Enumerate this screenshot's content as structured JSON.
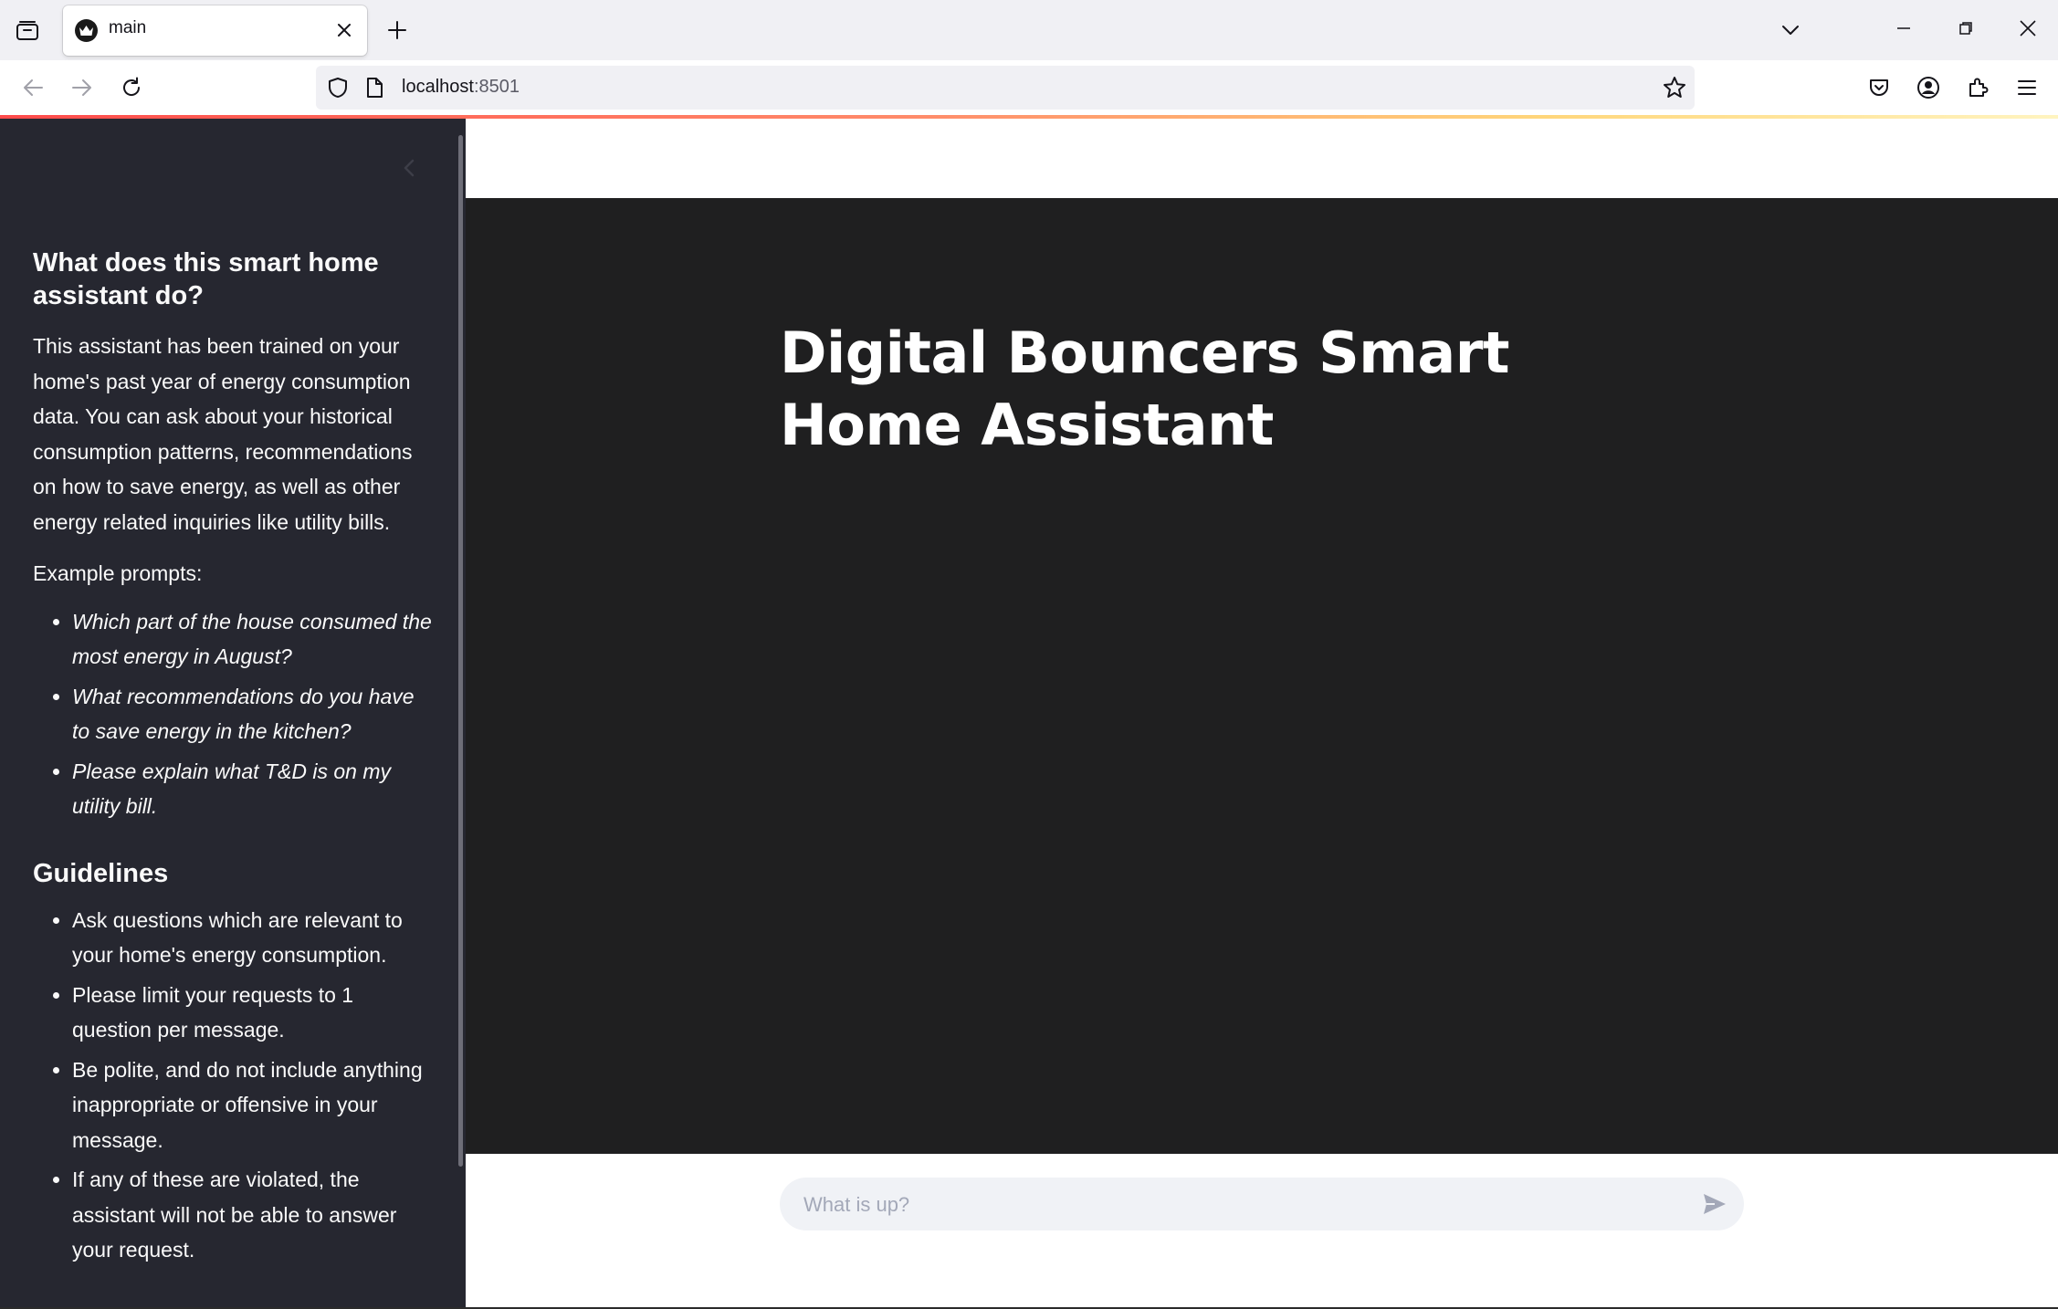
{
  "browser": {
    "tab_title": "main",
    "url_host": "localhost",
    "url_port": ":8501"
  },
  "sidebar": {
    "heading": "What does this smart home assistant do?",
    "description": "This assistant has been trained on your home's past year of energy consumption data. You can ask about your historical consumption patterns, recommendations on how to save energy, as well as other energy related inquiries like utility bills.",
    "examples_label": "Example prompts:",
    "examples": [
      "Which part of the house consumed the most energy in August?",
      "What recommendations do you have to save energy in the kitchen?",
      "Please explain what T&D is on my utility bill."
    ],
    "guidelines_heading": "Guidelines",
    "guidelines": [
      "Ask questions which are relevant to your home's energy consumption.",
      "Please limit your requests to 1 question per message.",
      "Be polite, and do not include anything inappropriate or offensive in your message.",
      "If any of these are violated, the assistant will not be able to answer your request."
    ]
  },
  "main": {
    "title": "Digital Bouncers Smart Home Assistant",
    "chat_placeholder": "What is up?"
  },
  "colors": {
    "sidebar_bg": "#262730",
    "main_dark_bg": "#1f1f20",
    "accent": "#ff4b4b",
    "chat_input_bg": "#f0f2f6"
  }
}
